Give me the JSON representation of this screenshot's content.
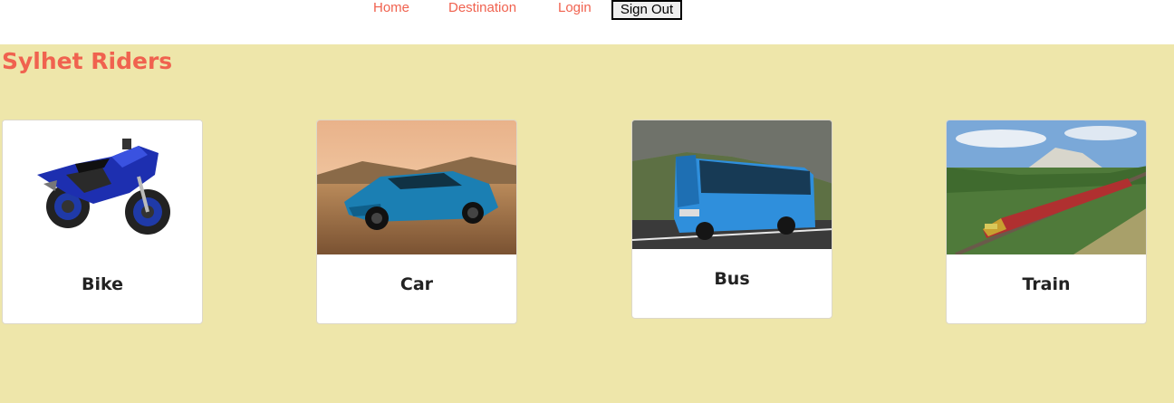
{
  "nav": {
    "home": "Home",
    "destination": "Destination",
    "login": "Login",
    "signout": "Sign Out"
  },
  "brand": "Sylhet Riders",
  "cards": [
    {
      "title": "Bike",
      "image": "motorcycle-image"
    },
    {
      "title": "Car",
      "image": "car-image"
    },
    {
      "title": "Bus",
      "image": "bus-image"
    },
    {
      "title": "Train",
      "image": "train-image"
    }
  ],
  "colors": {
    "accent": "#f0624f",
    "background": "#eee6aa",
    "card": "#ffffff"
  }
}
